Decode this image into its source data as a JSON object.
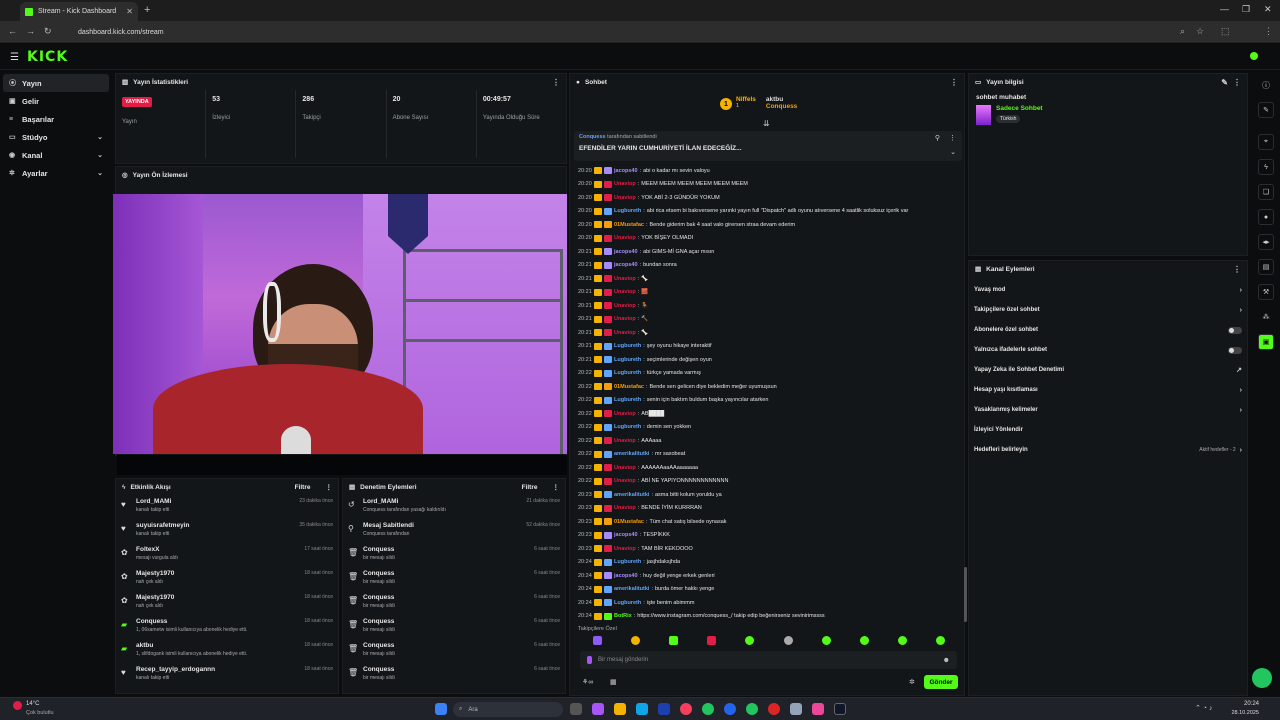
{
  "browser": {
    "tab_title": "Stream - Kick Dashboard",
    "url": "dashboard.kick.com/stream"
  },
  "brand": {
    "logo": "KICK",
    "accent": "#53fc18"
  },
  "sidebar": {
    "items": [
      {
        "label": "Yayın",
        "icon": "broadcast-icon"
      },
      {
        "label": "Gelir",
        "icon": "wallet-icon"
      },
      {
        "label": "Başarılar",
        "icon": "trophy-icon"
      },
      {
        "label": "Stüdyo",
        "icon": "layout-icon",
        "chev": "⌄"
      },
      {
        "label": "Kanal",
        "icon": "user-icon",
        "chev": "⌄"
      },
      {
        "label": "Ayarlar",
        "icon": "gear-icon",
        "chev": "⌄"
      }
    ]
  },
  "stats": {
    "title": "Yayın İstatistikleri",
    "live_badge": "YAYINDA",
    "items": [
      {
        "value": "",
        "label": "Yayın"
      },
      {
        "value": "53",
        "label": "İzleyici"
      },
      {
        "value": "286",
        "label": "Takipçi"
      },
      {
        "value": "20",
        "label": "Abone Sayısı"
      },
      {
        "value": "00:49:57",
        "label": "Yayında Olduğu Süre"
      }
    ]
  },
  "preview": {
    "title": "Yayın Ön İzlemesi"
  },
  "activity": {
    "title": "Etkinlik Akışı",
    "filter": "Filtre",
    "items": [
      {
        "name": "Lord_MAMi",
        "sub": "kanalı takip etti",
        "time": "23 dakika önce",
        "icon": "heart-icon"
      },
      {
        "name": "suyuisrafetmeyin",
        "sub": "kanalı takip etti",
        "time": "35 dakika önce",
        "icon": "heart-icon"
      },
      {
        "name": "FoltexX",
        "sub": "mesajı vurgula aldı",
        "time": "17 saat önce",
        "icon": "gift-icon"
      },
      {
        "name": "Majesty1970",
        "sub": "nah çek aldı",
        "time": "18 saat önce",
        "icon": "gift-icon"
      },
      {
        "name": "Majesty1970",
        "sub": "nah çek aldı",
        "time": "18 saat önce",
        "icon": "gift-icon"
      },
      {
        "name": "Conquess",
        "sub": "1, 06sametw isimli kullanıcıya abonelik hediye etti.",
        "time": "18 saat önce",
        "icon": "sub-icon"
      },
      {
        "name": "aktbu",
        "sub": "1, slifdogank isimli kullanıcıya abonelik hediye etti.",
        "time": "18 saat önce",
        "icon": "sub-icon"
      },
      {
        "name": "Recep_tayyip_erdogannn",
        "sub": "kanalı takip etti",
        "time": "18 saat önce",
        "icon": "heart-icon"
      }
    ]
  },
  "moderation": {
    "title": "Denetim Eylemleri",
    "filter": "Filtre",
    "items": [
      {
        "name": "Lord_MAMi",
        "sub": "Conquess tarafından yasağı kaldırıldı",
        "time": "21 dakika önce",
        "icon": "undo-icon"
      },
      {
        "name": "Mesaj Sabitlendi",
        "sub": "Conquess tarafından",
        "time": "52 dakika önce",
        "icon": "pin-icon"
      },
      {
        "name": "Conquess",
        "sub": "bir mesajı sildi",
        "time": "6 saat önce",
        "icon": "trash-icon"
      },
      {
        "name": "Conquess",
        "sub": "bir mesajı sildi",
        "time": "6 saat önce",
        "icon": "trash-icon"
      },
      {
        "name": "Conquess",
        "sub": "bir mesajı sildi",
        "time": "6 saat önce",
        "icon": "trash-icon"
      },
      {
        "name": "Conquess",
        "sub": "bir mesajı sildi",
        "time": "6 saat önce",
        "icon": "trash-icon"
      },
      {
        "name": "Conquess",
        "sub": "bir mesajı sildi",
        "time": "6 saat önce",
        "icon": "trash-icon"
      },
      {
        "name": "Conquess",
        "sub": "bir mesajı sildi",
        "time": "6 saat önce",
        "icon": "trash-icon"
      }
    ]
  },
  "chat": {
    "title": "Sohbet",
    "top_users": [
      {
        "name": "Niffels",
        "count": "1"
      },
      {
        "name": "aktbu",
        "count": "1"
      },
      {
        "name": "Conquess",
        "count": "1"
      }
    ],
    "pinned": {
      "by": "Conquess",
      "by_suffix": "tarafından sabitlendi",
      "text": "EFENDİLER YARIN CUMHURİYETİ İLAN EDECEĞİZ..."
    },
    "messages": [
      {
        "t": "20:20",
        "u": "jacops40",
        "c": "#a78bfa",
        "m": "abi o kadar mı sevin valoyu"
      },
      {
        "t": "20:20",
        "u": "Unaviop",
        "c": "#e11d48",
        "m": "MEEM MEEM MEEM MEEM MEEM MEEM"
      },
      {
        "t": "20:20",
        "u": "Unaviop",
        "c": "#e11d48",
        "m": "YOK ABİ 2-3 GÜNDÜR YOKUM"
      },
      {
        "t": "20:20",
        "u": "Lugbureth",
        "c": "#60a5fa",
        "m": "abi rica etsem bi bakıversene yarınki yayın full \"Dispatch\" adlı oyunu atıversene 4 saatlik soluksuz içerik var"
      },
      {
        "t": "20:20",
        "u": "01Mustafac",
        "c": "#f59e0b",
        "m": "Bende giderim bak 4 saat valo girersen straa devam ederim"
      },
      {
        "t": "20:20",
        "u": "Unaviop",
        "c": "#e11d48",
        "m": "YOK BİŞEY OLMADI"
      },
      {
        "t": "20:21",
        "u": "jacops40",
        "c": "#a78bfa",
        "m": "abi GIMS-Mİ GNA açar mısın"
      },
      {
        "t": "20:21",
        "u": "jacops40",
        "c": "#a78bfa",
        "m": "bundan sonra"
      },
      {
        "t": "20:21",
        "u": "Unaviop",
        "c": "#e11d48",
        "m": "🦴"
      },
      {
        "t": "20:21",
        "u": "Unaviop",
        "c": "#e11d48",
        "m": "🧱"
      },
      {
        "t": "20:21",
        "u": "Unaviop",
        "c": "#e11d48",
        "m": "🪑"
      },
      {
        "t": "20:21",
        "u": "Unaviop",
        "c": "#e11d48",
        "m": "🔨"
      },
      {
        "t": "20:21",
        "u": "Unaviop",
        "c": "#e11d48",
        "m": "🦴"
      },
      {
        "t": "20:21",
        "u": "Lugbureth",
        "c": "#60a5fa",
        "m": "şey oyunu hikaye interaktif"
      },
      {
        "t": "20:21",
        "u": "Lugbureth",
        "c": "#60a5fa",
        "m": "seçimlerinde değişen oyun"
      },
      {
        "t": "20:22",
        "u": "Lugbureth",
        "c": "#60a5fa",
        "m": "türkçe yamada varmış"
      },
      {
        "t": "20:22",
        "u": "01Mustafac",
        "c": "#f59e0b",
        "m": "Bende sen gelicen diye bekledim meğer uyumuşsun"
      },
      {
        "t": "20:22",
        "u": "Lugbureth",
        "c": "#60a5fa",
        "m": "senin için baktım buldum başka yayıncılar atarken"
      },
      {
        "t": "20:22",
        "u": "Unaviop",
        "c": "#e11d48",
        "m": "AB████"
      },
      {
        "t": "20:22",
        "u": "Lugbureth",
        "c": "#60a5fa",
        "m": "demin sen yokken"
      },
      {
        "t": "20:22",
        "u": "Unaviop",
        "c": "#e11d48",
        "m": "AAAaaa"
      },
      {
        "t": "20:22",
        "u": "amerikalitutki",
        "c": "#60a5fa",
        "m": "mr saxobeat"
      },
      {
        "t": "20:22",
        "u": "Unaviop",
        "c": "#e11d48",
        "m": "AAAAAAaaAAaaaaaaa"
      },
      {
        "t": "20:22",
        "u": "Unaviop",
        "c": "#e11d48",
        "m": "ABİ NE YAPIYONNNNNNNNNNNN"
      },
      {
        "t": "20:23",
        "u": "amerikalitutki",
        "c": "#60a5fa",
        "m": "asma bitti kolum yoruldu ya"
      },
      {
        "t": "20:23",
        "u": "Unaviop",
        "c": "#e11d48",
        "m": "BENDE İYİM KURRRAN"
      },
      {
        "t": "20:23",
        "u": "01Mustafac",
        "c": "#f59e0b",
        "m": "Tüm chat satış bilsede oynasak"
      },
      {
        "t": "20:23",
        "u": "jacops40",
        "c": "#a78bfa",
        "m": "TESPİKKK"
      },
      {
        "t": "20:23",
        "u": "Unaviop",
        "c": "#e11d48",
        "m": "TAM BİR KEKOOOO"
      },
      {
        "t": "20:24",
        "u": "Lugbureth",
        "c": "#60a5fa",
        "m": "jasjhdaksjhda"
      },
      {
        "t": "20:24",
        "u": "jacops40",
        "c": "#a78bfa",
        "m": "huy değil yenge erkek genleri"
      },
      {
        "t": "20:24",
        "u": "amerikalitutki",
        "c": "#60a5fa",
        "m": "burda ömer hakkı yenge"
      },
      {
        "t": "20:24",
        "u": "Lugbureth",
        "c": "#60a5fa",
        "m": "işte benim abimmm"
      },
      {
        "t": "20:24",
        "u": "BotRix",
        "c": "#53fc18",
        "m": "https://www.instagram.com/conquess_/ takip edip beğenirseniz sevinirimssss"
      }
    ],
    "followers_only": "Takipçilere Özel",
    "input_placeholder": "Bir mesaj gönderin",
    "send": "Gönder"
  },
  "stream_info": {
    "title": "Yayın bilgisi",
    "stream_title": "sohbet muhabet",
    "category": "Sadece Sohbet",
    "tag": "Türkish"
  },
  "channel_actions": {
    "title": "Kanal Eylemleri",
    "items": [
      {
        "label": "Yavaş mod",
        "right": "›"
      },
      {
        "label": "Takipçilere özel sohbet",
        "right": "›"
      },
      {
        "label": "Abonelere özel sohbet",
        "right": "toggle"
      },
      {
        "label": "Yalnızca ifadelerle sohbet",
        "right": "toggle"
      },
      {
        "label": "Yapay Zeka ile Sohbet Denetimi",
        "right": "↗"
      },
      {
        "label": "Hesap yaşı kısıtlaması",
        "right": "›"
      },
      {
        "label": "Yasaklanmış kelimeler",
        "right": "›"
      },
      {
        "label": "İzleyici Yönlendir",
        "right": ""
      },
      {
        "label": "Hedefleri belirleyin",
        "right": "›",
        "extra": "Aktif hedefler - 2"
      }
    ]
  },
  "taskbar": {
    "weather_temp": "14°C",
    "weather_desc": "Çok bulutlu",
    "search": "Ara",
    "time": "20:24",
    "date": "28.10.2025"
  }
}
